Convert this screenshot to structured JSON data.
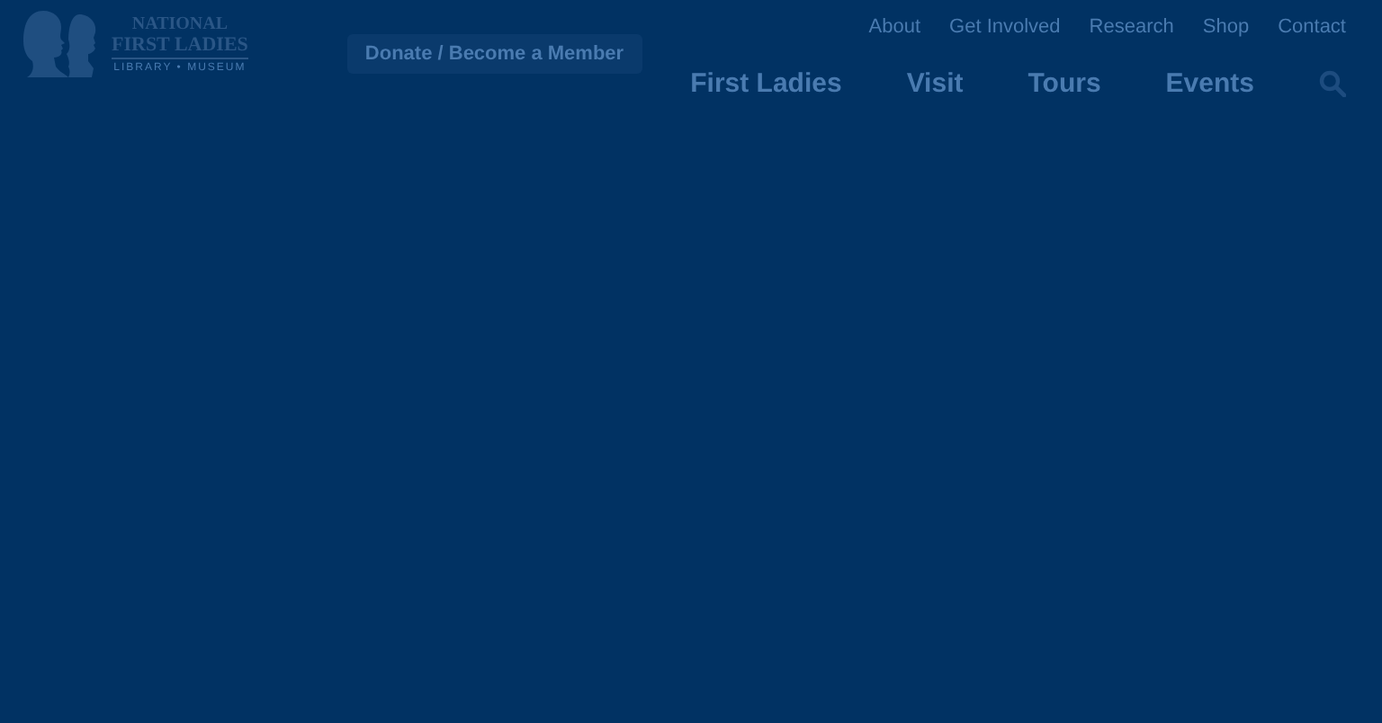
{
  "logo": {
    "line_1": "NATIONAL",
    "line_2": "FIRST LADIES",
    "line_3": "LIBRARY • MUSEUM"
  },
  "donate_button": "Donate / Become a Member",
  "utility_nav": [
    "About",
    "Get Involved",
    "Research",
    "Shop",
    "Contact"
  ],
  "main_nav": [
    "First Ladies",
    "Visit",
    "Tours",
    "Events"
  ]
}
